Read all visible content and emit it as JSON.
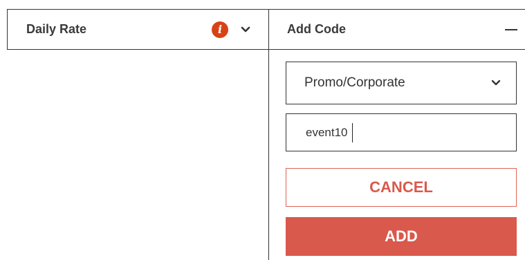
{
  "rate_panel": {
    "label": "Daily Rate",
    "info_icon": "info-icon",
    "info_glyph": "i",
    "toggle_icon": "chevron-down-icon"
  },
  "add_code": {
    "header_label": "Add Code",
    "collapse_icon": "minus-icon",
    "code_type": {
      "selected": "Promo/Corporate",
      "icon": "chevron-down-icon"
    },
    "code_field": {
      "value": "event10"
    },
    "cancel_label": "CANCEL",
    "add_label": "ADD"
  },
  "colors": {
    "accent": "#d9594c",
    "info": "#d84315",
    "border": "#333333"
  }
}
